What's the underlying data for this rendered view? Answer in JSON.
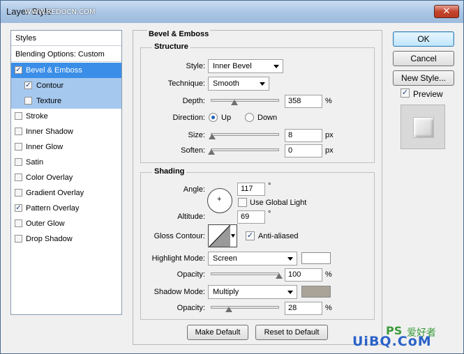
{
  "window": {
    "title": "Layer Style",
    "watermark": "WWW.REDOCN.COM",
    "close_glyph": "✕"
  },
  "styles_list": {
    "header": "Styles",
    "blending": "Blending Options: Custom",
    "items": [
      {
        "label": "Bevel & Emboss",
        "checked": true
      },
      {
        "label": "Contour",
        "checked": true
      },
      {
        "label": "Texture",
        "checked": false
      },
      {
        "label": "Stroke",
        "checked": false
      },
      {
        "label": "Inner Shadow",
        "checked": false
      },
      {
        "label": "Inner Glow",
        "checked": false
      },
      {
        "label": "Satin",
        "checked": false
      },
      {
        "label": "Color Overlay",
        "checked": false
      },
      {
        "label": "Gradient Overlay",
        "checked": false
      },
      {
        "label": "Pattern Overlay",
        "checked": true
      },
      {
        "label": "Outer Glow",
        "checked": false
      },
      {
        "label": "Drop Shadow",
        "checked": false
      }
    ]
  },
  "panel": {
    "title": "Bevel & Emboss",
    "structure": {
      "title": "Structure",
      "style_label": "Style:",
      "style_value": "Inner Bevel",
      "technique_label": "Technique:",
      "technique_value": "Smooth",
      "depth_label": "Depth:",
      "depth_value": "358",
      "depth_unit": "%",
      "direction_label": "Direction:",
      "direction_up": "Up",
      "direction_down": "Down",
      "size_label": "Size:",
      "size_value": "8",
      "size_unit": "px",
      "soften_label": "Soften:",
      "soften_value": "0",
      "soften_unit": "px"
    },
    "shading": {
      "title": "Shading",
      "angle_label": "Angle:",
      "angle_value": "117",
      "angle_unit": "°",
      "global_light_label": "Use Global Light",
      "altitude_label": "Altitude:",
      "altitude_value": "69",
      "altitude_unit": "°",
      "gloss_label": "Gloss Contour:",
      "antialiased_label": "Anti-aliased",
      "highlight_mode_label": "Highlight Mode:",
      "highlight_mode_value": "Screen",
      "highlight_color": "#ffffff",
      "highlight_opacity_label": "Opacity:",
      "highlight_opacity_value": "100",
      "highlight_opacity_unit": "%",
      "shadow_mode_label": "Shadow Mode:",
      "shadow_mode_value": "Multiply",
      "shadow_color": "#a9a398",
      "shadow_opacity_label": "Opacity:",
      "shadow_opacity_value": "28",
      "shadow_opacity_unit": "%"
    },
    "make_default": "Make Default",
    "reset_default": "Reset to Default"
  },
  "right": {
    "ok": "OK",
    "cancel": "Cancel",
    "new_style": "New Style...",
    "preview_label": "Preview"
  },
  "footer_watermark": {
    "logo": "PS",
    "brand": "UiBQ.CoM",
    "cn_text": "爱好者"
  }
}
